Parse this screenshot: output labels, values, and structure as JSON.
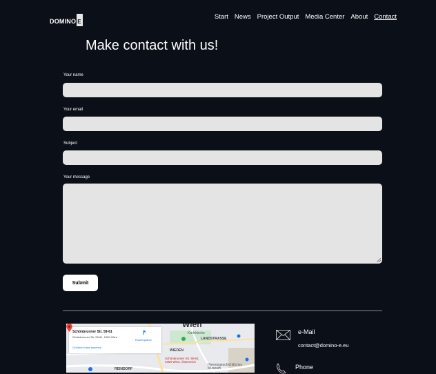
{
  "header": {
    "logo_text": "DOMINO",
    "logo_box_text": "E",
    "nav": [
      "Start",
      "News",
      "Project Output",
      "Media Center",
      "About",
      "Contact"
    ],
    "active_nav": "Contact"
  },
  "page": {
    "title": "Make contact with us!"
  },
  "form": {
    "name_label": "Your name",
    "email_label": "Your email",
    "subject_label": "Subject",
    "message_label": "Your message",
    "submit_label": "Submit"
  },
  "map": {
    "place_name": "Schönbrunner Str. 59-61",
    "place_address": "Schönbrunner Str. 59-61, 1050 Wien",
    "larger_map_link": "Größere Karte ansehen",
    "route_label": "Routenplaner",
    "pin_label_line1": "Schönbrunner Str. 59-61",
    "pin_label_line2": "1050 Wien, Österreich",
    "city_label": "Wien",
    "district_wieden": "WIEDEN",
    "district_landstrasse": "LANDSTRASSE",
    "district_reindorf": "REINDORF",
    "poi_karlskirche": "Karlskirche",
    "poi_museum": "Heeresgeschichtliches Museum"
  },
  "contact": {
    "email_title": "e-Mail",
    "email_value": "contact@domino-e.eu",
    "phone_title": "Phone"
  },
  "colors": {
    "background": "#0b0f18",
    "field": "#e4e4e4",
    "divider": "#8a8d93"
  }
}
